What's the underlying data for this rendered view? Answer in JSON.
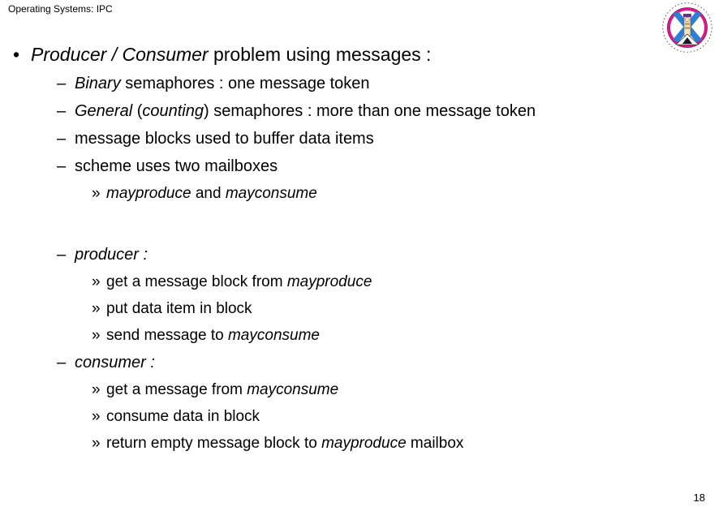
{
  "header": {
    "title": "Operating Systems: IPC"
  },
  "logo": {
    "name": "university-of-edinburgh-crest",
    "ring_color": "#d81b8c",
    "cross_color": "#2b7fd4",
    "ring_text": "THE UNIVERSITY OF EDINBURGH"
  },
  "content": {
    "bullet_marker": "•",
    "dash_marker": "–",
    "guillemet_marker": "»",
    "main_bullet": {
      "emphasis": "Producer / Consumer",
      "rest": " problem using messages :"
    },
    "sub_bullets": [
      {
        "emphasis": "Binary",
        "rest": " semaphores : one message token"
      },
      {
        "emphasis": "General",
        "mid": " (",
        "emphasis2": "counting",
        "rest": ") semaphores : more than one message token"
      },
      {
        "rest": "message blocks used to buffer data items"
      },
      {
        "rest": "scheme uses two mailboxes"
      }
    ],
    "mailboxes_line": {
      "emphasis": "mayproduce",
      "mid": " and  ",
      "emphasis2": "mayconsume"
    },
    "producer": {
      "heading": "producer :",
      "steps": [
        {
          "pre": "get a message block from ",
          "emphasis": "mayproduce",
          "post": ""
        },
        {
          "pre": "put data item in block",
          "emphasis": "",
          "post": ""
        },
        {
          "pre": "send message to ",
          "emphasis": "mayconsume",
          "post": ""
        }
      ]
    },
    "consumer": {
      "heading": "consumer :",
      "steps": [
        {
          "pre": "get a message from ",
          "emphasis": "mayconsume",
          "post": ""
        },
        {
          "pre": "consume data in block",
          "emphasis": "",
          "post": ""
        },
        {
          "pre": "return empty message block to ",
          "emphasis": "mayproduce",
          "post": " mailbox"
        }
      ]
    }
  },
  "footer": {
    "page_number": "18"
  }
}
